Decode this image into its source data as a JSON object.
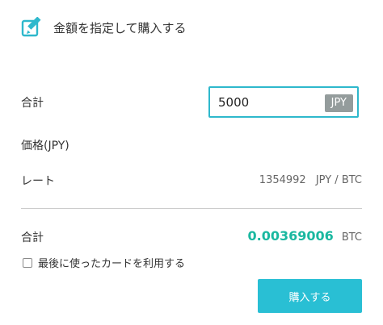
{
  "header": {
    "icon": "edit-icon",
    "title": "金額を指定して購入する",
    "accent_color": "#2eb8cc"
  },
  "form": {
    "total_label": "合計",
    "amount_value": "5000",
    "amount_currency": "JPY",
    "price_label": "価格(JPY)",
    "rate_label": "レート",
    "rate_value": "1354992",
    "rate_unit": "JPY / BTC"
  },
  "result": {
    "total_label": "合計",
    "btc_amount": "0.00369006",
    "btc_unit": "BTC",
    "amount_color": "#1ab8a0"
  },
  "remember_card": {
    "label": "最後に使ったカードを利用する",
    "checked": false
  },
  "buy_button": {
    "label": "購入する",
    "color": "#29bfd4"
  }
}
